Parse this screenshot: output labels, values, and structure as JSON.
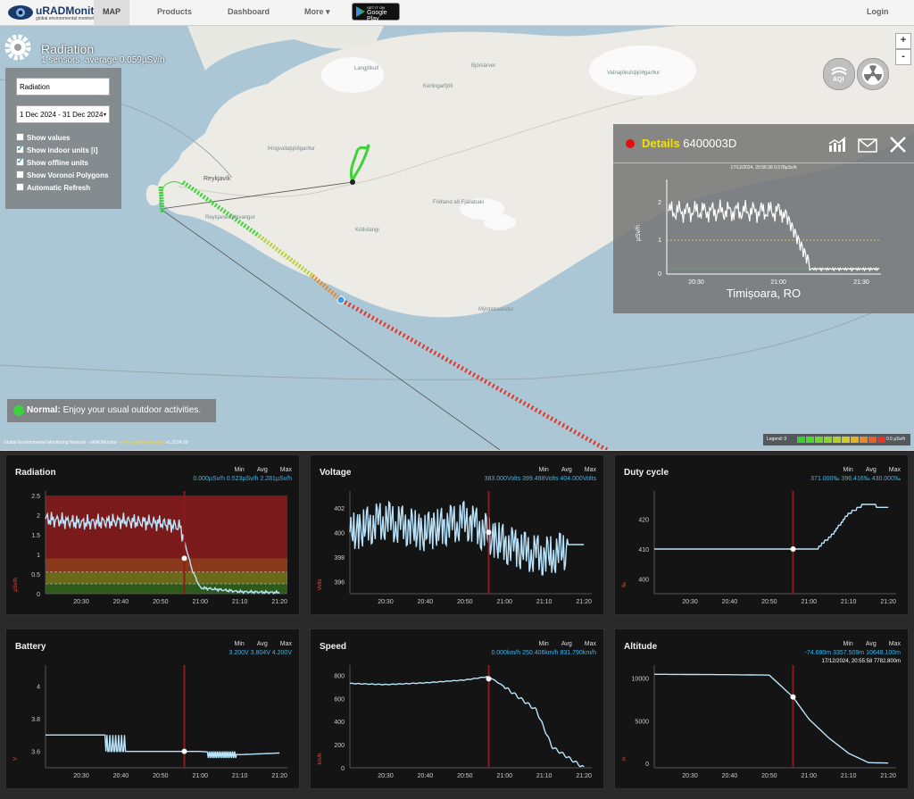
{
  "nav": {
    "logo_title": "uRADMonitor",
    "logo_subtitle": "global environmental monitoring network",
    "links": [
      "MAP",
      "Products",
      "Dashboard",
      "More ▾"
    ],
    "gplay_top": "GET IT ON",
    "gplay_bottom": "Google Play",
    "login": "Login"
  },
  "map": {
    "title": "Radiation",
    "subtitle": "1 sensors, average 0.059µSv/h",
    "sensor_select": "Radiation",
    "date_range": "1 Dec 2024 - 31 Dec 2024",
    "options": [
      {
        "label": "Show values",
        "checked": false
      },
      {
        "label": "Show indoor units [i]",
        "checked": true
      },
      {
        "label": "Show offline units",
        "checked": true
      },
      {
        "label": "Show Voronoi Polygons",
        "checked": false
      },
      {
        "label": "Automatic Refresh",
        "checked": false
      }
    ],
    "aqi_label": "AQI",
    "zoom_in": "+",
    "zoom_out": "-",
    "status_label": "Normal:",
    "status_text": " Enjoy your usual outdoor activities.",
    "attribution_a": "Global Environmental Monitoring Network - uRADMonitor - ",
    "attribution_link": "www.uradmonitor.com",
    "attribution_b": " v1.2024.09",
    "legend_left": "Legend: 0",
    "legend_right": "0.5 µSv/h",
    "legend_colors": [
      "#39d12f",
      "#52d42f",
      "#6fd52f",
      "#8fd42e",
      "#b0d22d",
      "#d1cd2c",
      "#e6b12b",
      "#e88a2a",
      "#e75f28",
      "#e53426"
    ],
    "place_labels": [
      "Langjökull",
      "Bjórsárver",
      "Kerlingarfjöll",
      "Vatnajökulsþjóðgarður",
      "Reykjavík",
      "Reykjanesfólkvangur",
      "Þingvallaþjóðgarður",
      "Friðland að Fjallabaki",
      "Kötlutangi",
      "Mýrdalssandur"
    ]
  },
  "details": {
    "label": "Details",
    "id": "6400003D",
    "stamp": "17/12/2024, 20:56:38 0.578µSv/h",
    "city": "Timișoara, RO",
    "ylabel": "µSv/h",
    "yticks": [
      "2",
      "1",
      "0"
    ],
    "xticks": [
      "20:30",
      "21:00",
      "21:30"
    ]
  },
  "panels": [
    {
      "title": "Radiation",
      "min": "0.000µSv/h",
      "avg": "0.523µSv/h",
      "max": "2.281µSv/h",
      "unit": "µSv/h",
      "yticks": [
        "2.5",
        "2",
        "1.5",
        "1",
        "0.5",
        "0"
      ],
      "xticks": [
        "20:30",
        "20:40",
        "20:50",
        "21:00",
        "21:10",
        "21:20"
      ]
    },
    {
      "title": "Voltage",
      "min": "383.000Volts",
      "avg": "399.488Volts",
      "max": "404.000Volts",
      "unit": "Volts",
      "yticks": [
        "402",
        "400",
        "398",
        "396"
      ],
      "xticks": [
        "20:30",
        "20:40",
        "20:50",
        "21:00",
        "21:10",
        "21:20"
      ]
    },
    {
      "title": "Duty cycle",
      "min": "371.000‰",
      "avg": "396.416‰",
      "max": "430.000‰",
      "unit": "‰",
      "yticks": [
        "420",
        "410",
        "400"
      ],
      "xticks": [
        "20:30",
        "20:40",
        "20:50",
        "21:00",
        "21:10",
        "21:20"
      ]
    },
    {
      "title": "Battery",
      "min": "3.200V",
      "avg": "3.804V",
      "max": "4.200V",
      "unit": "V",
      "yticks": [
        "4",
        "3.8",
        "3.6"
      ],
      "xticks": [
        "20:30",
        "20:40",
        "20:50",
        "21:00",
        "21:10",
        "21:20"
      ]
    },
    {
      "title": "Speed",
      "min": "0.000km/h",
      "avg": "250.406km/h",
      "max": "831.790km/h",
      "unit": "km/h",
      "yticks": [
        "800",
        "600",
        "400",
        "200",
        "0"
      ],
      "xticks": [
        "20:30",
        "20:40",
        "20:50",
        "21:00",
        "21:10",
        "21:20"
      ]
    },
    {
      "title": "Altitude",
      "min": "-74.690m",
      "avg": "3357.509m",
      "max": "10648.100m",
      "unit": "m",
      "extra": "17/12/2024, 20:55:58 7782.800m",
      "yticks": [
        "10000",
        "5000",
        "0"
      ],
      "xticks": [
        "20:30",
        "20:40",
        "20:50",
        "21:00",
        "21:10",
        "21:20"
      ]
    }
  ],
  "stat_headers": [
    "Min",
    "Avg",
    "Max"
  ],
  "colors": {
    "line": "#b9e4fb",
    "cursor": "#8b1a1a",
    "accent": "#38b6f2"
  },
  "chart_data": [
    {
      "type": "line",
      "title": "Radiation",
      "ylabel": "µSv/h",
      "x": [
        "20:21",
        "20:30",
        "20:40",
        "20:50",
        "20:55",
        "20:58",
        "21:00",
        "21:10",
        "21:20"
      ],
      "values": [
        1.9,
        1.8,
        1.85,
        1.8,
        1.7,
        0.6,
        0.15,
        0.05,
        0.03
      ],
      "ylim": [
        0,
        2.5
      ]
    },
    {
      "type": "line",
      "title": "Voltage",
      "ylabel": "Volts",
      "x": [
        "20:21",
        "20:30",
        "20:40",
        "20:50",
        "21:00",
        "21:10",
        "21:20"
      ],
      "values": [
        400,
        401,
        400,
        401,
        399,
        398,
        399
      ],
      "ylim": [
        395,
        403
      ]
    },
    {
      "type": "line",
      "title": "Duty cycle",
      "ylabel": "‰",
      "x": [
        "20:21",
        "20:40",
        "20:56",
        "21:02",
        "21:06",
        "21:10",
        "21:14",
        "21:20"
      ],
      "values": [
        410,
        410,
        410,
        410,
        415,
        422,
        425,
        424
      ],
      "ylim": [
        395,
        428
      ]
    },
    {
      "type": "line",
      "title": "Battery",
      "ylabel": "V",
      "x": [
        "20:21",
        "20:36",
        "20:40",
        "21:00",
        "21:10",
        "21:20"
      ],
      "values": [
        3.7,
        3.7,
        3.6,
        3.6,
        3.58,
        3.59
      ],
      "ylim": [
        3.5,
        4.1
      ]
    },
    {
      "type": "line",
      "title": "Speed",
      "ylabel": "km/h",
      "x": [
        "20:21",
        "20:30",
        "20:40",
        "20:50",
        "20:56",
        "21:00",
        "21:08",
        "21:12",
        "21:20"
      ],
      "values": [
        730,
        720,
        735,
        760,
        790,
        700,
        500,
        180,
        0
      ],
      "ylim": [
        0,
        850
      ]
    },
    {
      "type": "line",
      "title": "Altitude",
      "ylabel": "m",
      "x": [
        "20:21",
        "20:40",
        "20:50",
        "20:56",
        "21:00",
        "21:05",
        "21:10",
        "21:15",
        "21:20"
      ],
      "values": [
        10450,
        10400,
        10350,
        7780,
        5200,
        3000,
        1200,
        100,
        50
      ],
      "ylim": [
        -500,
        11000
      ]
    }
  ]
}
